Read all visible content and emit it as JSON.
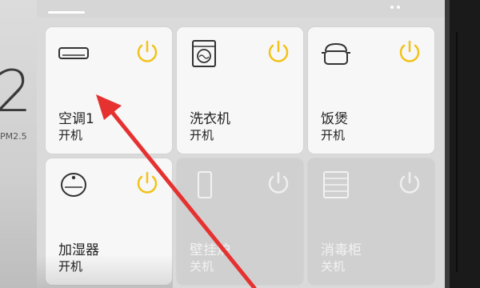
{
  "backdrop": {
    "big_value": "2",
    "pm_label": "PM2.5"
  },
  "devices": [
    {
      "name": "空调1",
      "state": "开机",
      "icon": "air-conditioner-icon",
      "on": true
    },
    {
      "name": "洗衣机",
      "state": "开机",
      "icon": "washing-machine-icon",
      "on": true
    },
    {
      "name": "饭煲",
      "state": "开机",
      "icon": "rice-cooker-icon",
      "on": true
    },
    {
      "name": "加湿器",
      "state": "开机",
      "icon": "humidifier-icon",
      "on": true
    },
    {
      "name": "壁挂炉",
      "state": "关机",
      "icon": "wall-boiler-icon",
      "on": false
    },
    {
      "name": "消毒柜",
      "state": "关机",
      "icon": "disinfection-cabinet-icon",
      "on": false
    }
  ],
  "colors": {
    "power_on": "#f2c21b",
    "power_off": "#efefef",
    "arrow": "#e53130",
    "tile_on": "#f7f7f7",
    "tile_off": "#d0d0d0"
  }
}
